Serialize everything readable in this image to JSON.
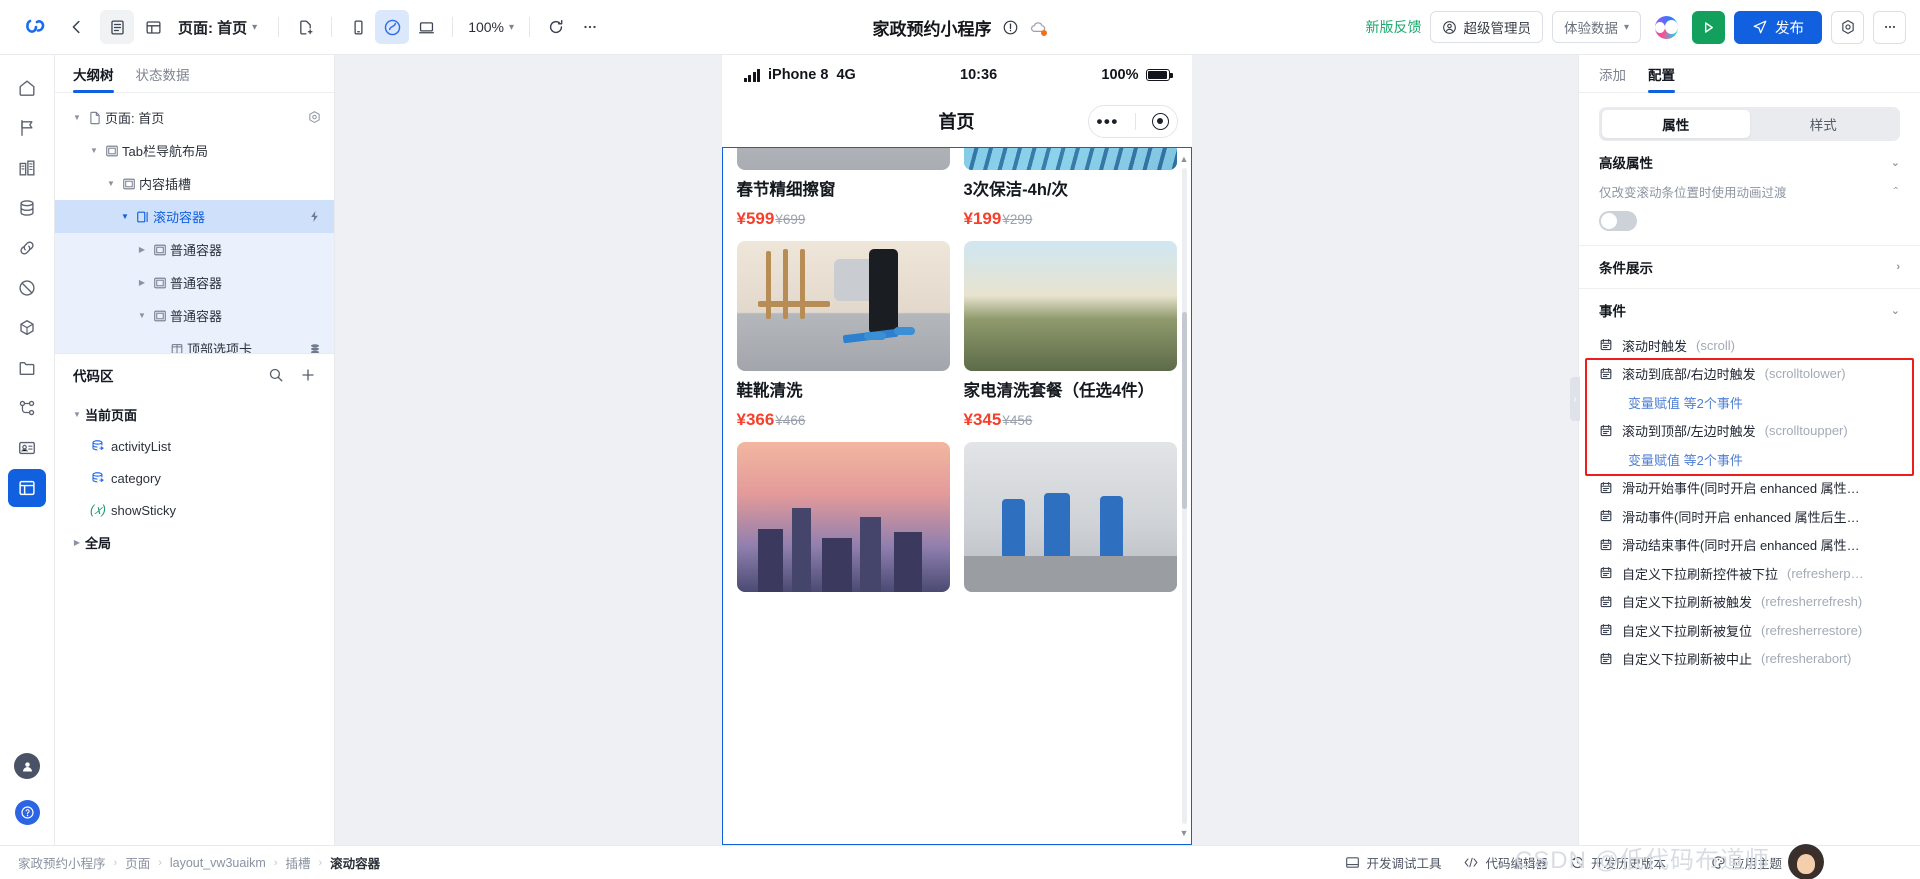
{
  "topbar": {
    "back_icon": "back-arrow-icon",
    "view_list_icon": "list-view-icon",
    "view_grid_icon": "grid-view-icon",
    "page_label": "页面: 首页",
    "new_page_icon": "new-page-icon",
    "device_mobile_icon": "mobile-device-icon",
    "device_mini_icon": "miniprogram-device-icon",
    "device_desktop_icon": "desktop-device-icon",
    "zoom_value": "100%",
    "refresh_icon": "refresh-icon",
    "more_icon": "more-horizontal-icon",
    "app_title": "家政预约小程序",
    "info_icon": "info-circle-icon",
    "cloud_icon": "cloud-status-icon",
    "feedback_link": "新版反馈",
    "role_label": "超级管理员",
    "role_icon": "user-circle-icon",
    "env_label": "体验数据",
    "ai_icon": "ai-assistant-icon",
    "preview_icon": "play-preview-icon",
    "publish_label": "发布",
    "publish_icon": "send-icon",
    "settings_icon": "settings-hexagon-icon",
    "more_right_icon": "more-horizontal-icon"
  },
  "rail": {
    "items": [
      {
        "name": "home",
        "icon": "home-icon"
      },
      {
        "name": "pages",
        "icon": "flag-icon"
      },
      {
        "name": "components",
        "icon": "building-icon"
      },
      {
        "name": "data",
        "icon": "database-icon"
      },
      {
        "name": "connector",
        "icon": "link-icon"
      },
      {
        "name": "permission",
        "icon": "shield-slash-icon"
      },
      {
        "name": "model",
        "icon": "cube-icon"
      },
      {
        "name": "assets",
        "icon": "folder-icon"
      },
      {
        "name": "workflow",
        "icon": "flow-icon"
      },
      {
        "name": "members",
        "icon": "id-card-icon"
      },
      {
        "name": "editor",
        "icon": "layout-active-icon"
      }
    ],
    "bottom": [
      {
        "name": "account",
        "icon": "account-avatar-icon"
      },
      {
        "name": "help",
        "icon": "help-circle-icon"
      }
    ]
  },
  "left_panel": {
    "tabs": [
      {
        "label": "大纲树",
        "active": true
      },
      {
        "label": "状态数据",
        "active": false
      }
    ],
    "tree": [
      {
        "label": "页面: 首页",
        "depth": 0,
        "arrow": "down",
        "icon": "page-icon",
        "right_icon": "settings-hexagon-icon",
        "selected": false,
        "inband": false
      },
      {
        "label": "Tab栏导航布局",
        "depth": 1,
        "arrow": "down",
        "icon": "container-icon",
        "right_icon": "",
        "selected": false,
        "inband": false
      },
      {
        "label": "内容插槽",
        "depth": 2,
        "arrow": "down",
        "icon": "container-icon",
        "right_icon": "",
        "selected": false,
        "inband": false
      },
      {
        "label": "滚动容器",
        "depth": 3,
        "arrow": "down",
        "icon": "scroll-container-icon",
        "right_icon": "bolt-icon",
        "selected": true,
        "inband": false
      },
      {
        "label": "普通容器",
        "depth": 4,
        "arrow": "right",
        "icon": "container-icon",
        "right_icon": "",
        "selected": false,
        "inband": true
      },
      {
        "label": "普通容器",
        "depth": 4,
        "arrow": "right",
        "icon": "container-icon",
        "right_icon": "",
        "selected": false,
        "inband": true
      },
      {
        "label": "普通容器",
        "depth": 4,
        "arrow": "down",
        "icon": "container-icon",
        "right_icon": "",
        "selected": false,
        "inband": true
      },
      {
        "label": "顶部选项卡",
        "depth": 5,
        "arrow": "none",
        "icon": "tabs-icon",
        "right_icon": "stack-icon",
        "selected": false,
        "inband": true
      }
    ],
    "code_area": {
      "title": "代码区",
      "search_icon": "search-icon",
      "add_icon": "plus-icon",
      "groups": [
        {
          "label": "当前页面",
          "arrow": "down",
          "items": [
            {
              "label": "activityList",
              "icon": "datasource-icon"
            },
            {
              "label": "category",
              "icon": "datasource-icon"
            },
            {
              "label": "showSticky",
              "icon": "variable-icon"
            }
          ]
        },
        {
          "label": "全局",
          "arrow": "right",
          "items": []
        }
      ]
    }
  },
  "canvas": {
    "status_bar": {
      "signal_icon": "signal-bars-icon",
      "device": "iPhone 8",
      "network": "4G",
      "time": "10:36",
      "battery_text": "100%",
      "battery_icon": "battery-full-icon"
    },
    "nav_title": "首页",
    "capsule": {
      "more_icon": "more-dots-icon",
      "target_icon": "target-circle-icon"
    },
    "products": [
      {
        "title": "春节精细擦窗",
        "price": "¥599",
        "old_price": "¥699",
        "scene": "sc1"
      },
      {
        "title": "3次保洁-4h/次",
        "price": "¥199",
        "old_price": "¥299",
        "scene": "sc2"
      },
      {
        "title": "鞋靴清洗",
        "price": "¥366",
        "old_price": "¥466",
        "scene": "sc3"
      },
      {
        "title": "家电清洗套餐（任选4件）",
        "price": "¥345",
        "old_price": "¥456",
        "scene": "sc4"
      },
      {
        "title": "",
        "price": "",
        "old_price": "",
        "scene": "sc5"
      },
      {
        "title": "",
        "price": "",
        "old_price": "",
        "scene": "sc6"
      }
    ],
    "scrollbar": {
      "up_icon": "chevron-up-icon",
      "down_icon": "chevron-down-icon"
    }
  },
  "right_panel": {
    "tabs": [
      {
        "label": "添加",
        "active": false
      },
      {
        "label": "配置",
        "active": true
      }
    ],
    "segment": [
      {
        "label": "属性",
        "active": true
      },
      {
        "label": "样式",
        "active": false
      }
    ],
    "advanced": {
      "title": "高级属性",
      "chevron": "chevron-down-icon",
      "clipped_label": "仅改变滚动条位置时使用动画过渡",
      "toggle_on": false
    },
    "condition": {
      "title": "条件展示",
      "chevron": "chevron-right-icon"
    },
    "events": {
      "title": "事件",
      "chevron": "chevron-down-icon",
      "items": [
        {
          "label": "滚动时触发",
          "code": "(scroll)",
          "icon": "event-icon",
          "sub": "",
          "highlight": false
        },
        {
          "label": "滚动到底部/右边时触发",
          "code": "(scrolltolower)",
          "icon": "event-icon",
          "sub": "变量赋值 等2个事件",
          "highlight": true
        },
        {
          "label": "滚动到顶部/左边时触发",
          "code": "(scrolltoupper)",
          "icon": "event-icon",
          "sub": "变量赋值 等2个事件",
          "highlight": true
        },
        {
          "label": "滑动开始事件(同时开启 enhanced 属性…",
          "code": "",
          "icon": "event-icon",
          "sub": "",
          "highlight": false
        },
        {
          "label": "滑动事件(同时开启 enhanced 属性后生…",
          "code": "",
          "icon": "event-icon",
          "sub": "",
          "highlight": false
        },
        {
          "label": "滑动结束事件(同时开启 enhanced 属性…",
          "code": "",
          "icon": "event-icon",
          "sub": "",
          "highlight": false
        },
        {
          "label": "自定义下拉刷新控件被下拉",
          "code": "(refresherp…",
          "icon": "event-icon",
          "sub": "",
          "highlight": false
        },
        {
          "label": "自定义下拉刷新被触发",
          "code": "(refresherrefresh)",
          "icon": "event-icon",
          "sub": "",
          "highlight": false
        },
        {
          "label": "自定义下拉刷新被复位",
          "code": "(refresherrestore)",
          "icon": "event-icon",
          "sub": "",
          "highlight": false
        },
        {
          "label": "自定义下拉刷新被中止",
          "code": "(refresherabort)",
          "icon": "event-icon",
          "sub": "",
          "highlight": false
        }
      ]
    },
    "collapse_handle_icon": "chevron-right-icon"
  },
  "footer": {
    "breadcrumb": [
      "家政预约小程序",
      "页面",
      "layout_vw3uaikm",
      "插槽",
      "滚动容器"
    ],
    "actions": [
      {
        "label": "开发调试工具",
        "icon": "debug-panel-icon"
      },
      {
        "label": "代码编辑器",
        "icon": "code-brackets-icon"
      },
      {
        "label": "开发历史版本",
        "icon": "history-clock-icon"
      },
      {
        "label": "应用主题",
        "icon": "theme-palette-icon"
      }
    ],
    "watermark": "CSDN @低代码布道师"
  }
}
